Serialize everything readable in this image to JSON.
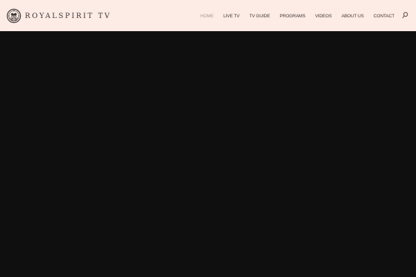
{
  "header": {
    "background": "#fdebe5",
    "logo": {
      "emblem_icon": "crest-emblem-icon",
      "text": "ROYALSPIRIT TV"
    },
    "nav": [
      {
        "label": "HOME",
        "active": true
      },
      {
        "label": "LIVE TV",
        "active": false
      },
      {
        "label": "TV GUIDE",
        "active": false
      },
      {
        "label": "PROGRAMS",
        "active": false
      },
      {
        "label": "VIDEOS",
        "active": false
      },
      {
        "label": "ABOUT US",
        "active": false
      },
      {
        "label": "CONTACT",
        "active": false
      }
    ],
    "search_icon": "search-icon"
  },
  "main": {
    "background": "#0f0f0f"
  },
  "colors": {
    "nav_text": "#3b3535",
    "nav_active": "#a39b98"
  }
}
